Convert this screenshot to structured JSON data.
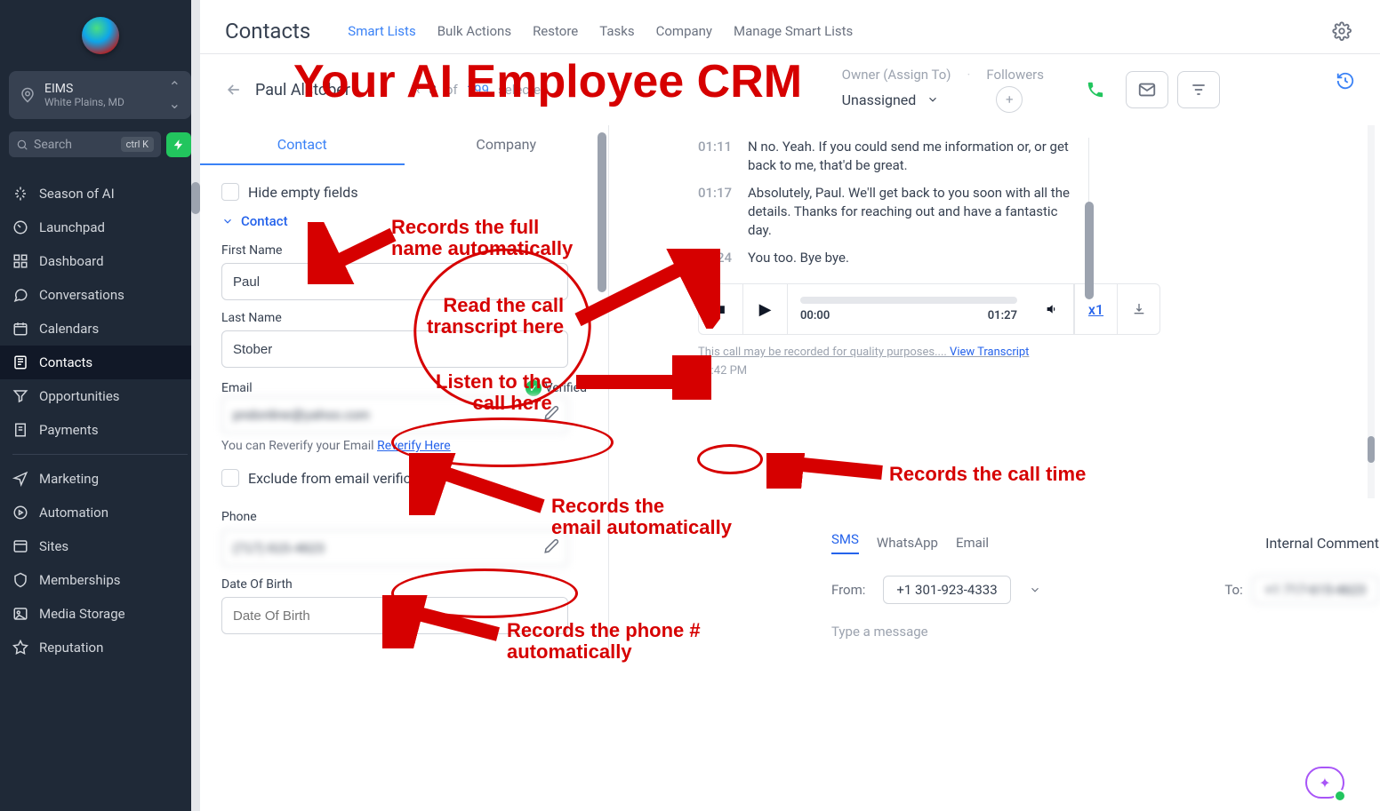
{
  "org": {
    "name": "EIMS",
    "location": "White Plains, MD"
  },
  "search": {
    "placeholder": "Search",
    "shortcut": "ctrl K"
  },
  "nav": {
    "items": [
      "Season of AI",
      "Launchpad",
      "Dashboard",
      "Conversations",
      "Calendars",
      "Contacts",
      "Opportunities",
      "Payments"
    ],
    "items2": [
      "Marketing",
      "Automation",
      "Sites",
      "Memberships",
      "Media Storage",
      "Reputation"
    ]
  },
  "header": {
    "title": "Contacts",
    "tabs": [
      "Smart Lists",
      "Bulk Actions",
      "Restore",
      "Tasks",
      "Company",
      "Manage Smart Lists"
    ]
  },
  "pager": {
    "name": "Paul Alstober",
    "pos": "8",
    "of_label": "of",
    "total": "199",
    "selected": "selected"
  },
  "owner": {
    "title": "Owner (Assign To)",
    "followers": "Followers",
    "value": "Unassigned"
  },
  "tabs2": {
    "contact": "Contact",
    "company": "Company"
  },
  "form": {
    "hide_empty": "Hide empty fields",
    "section": "Contact",
    "first_label": "First Name",
    "first_value": "Paul",
    "last_label": "Last Name",
    "last_value": "Stober",
    "email_label": "Email",
    "email_value": "pndonline@yahoo.com",
    "verified": "Verified",
    "reverify_pre": "You can Reverify your Email ",
    "reverify_link": "Reverify Here",
    "exclude": "Exclude from email verification",
    "phone_label": "Phone",
    "phone_value": "(717) 615-4623",
    "dob_label": "Date Of Birth",
    "dob_placeholder": "Date Of Birth"
  },
  "transcript": [
    {
      "t": "01:11",
      "text": "N no. Yeah. If you could send me information or, or get back to me, that'd be great."
    },
    {
      "t": "01:17",
      "text": "Absolutely, Paul. We'll get back to you soon with all the details. Thanks for reaching out and have a fantastic day."
    },
    {
      "t": "01:24",
      "text": "You too. Bye bye."
    }
  ],
  "player": {
    "cur": "00:00",
    "dur": "01:27",
    "speed": "x1"
  },
  "rec_note": {
    "pre": "This call may be recorded for quality purposes.... ",
    "link": "View Transcript"
  },
  "call_time": "12:42 PM",
  "compose": {
    "tabs": [
      "SMS",
      "WhatsApp",
      "Email"
    ],
    "internal": "Internal Comment",
    "from_label": "From:",
    "from_num": "+1 301-923-4333",
    "to_label": "To:",
    "to_num": "+1 717-615-4623",
    "placeholder": "Type a message"
  },
  "anno": {
    "title": "Your AI Employee CRM",
    "name": "Records the full\nname automatically",
    "transcript": "Read the call\ntranscript here",
    "listen": "Listen to the\ncall here",
    "email": "Records the\nemail automatically",
    "phone": "Records the phone #\nautomatically",
    "time": "Records the call time"
  }
}
